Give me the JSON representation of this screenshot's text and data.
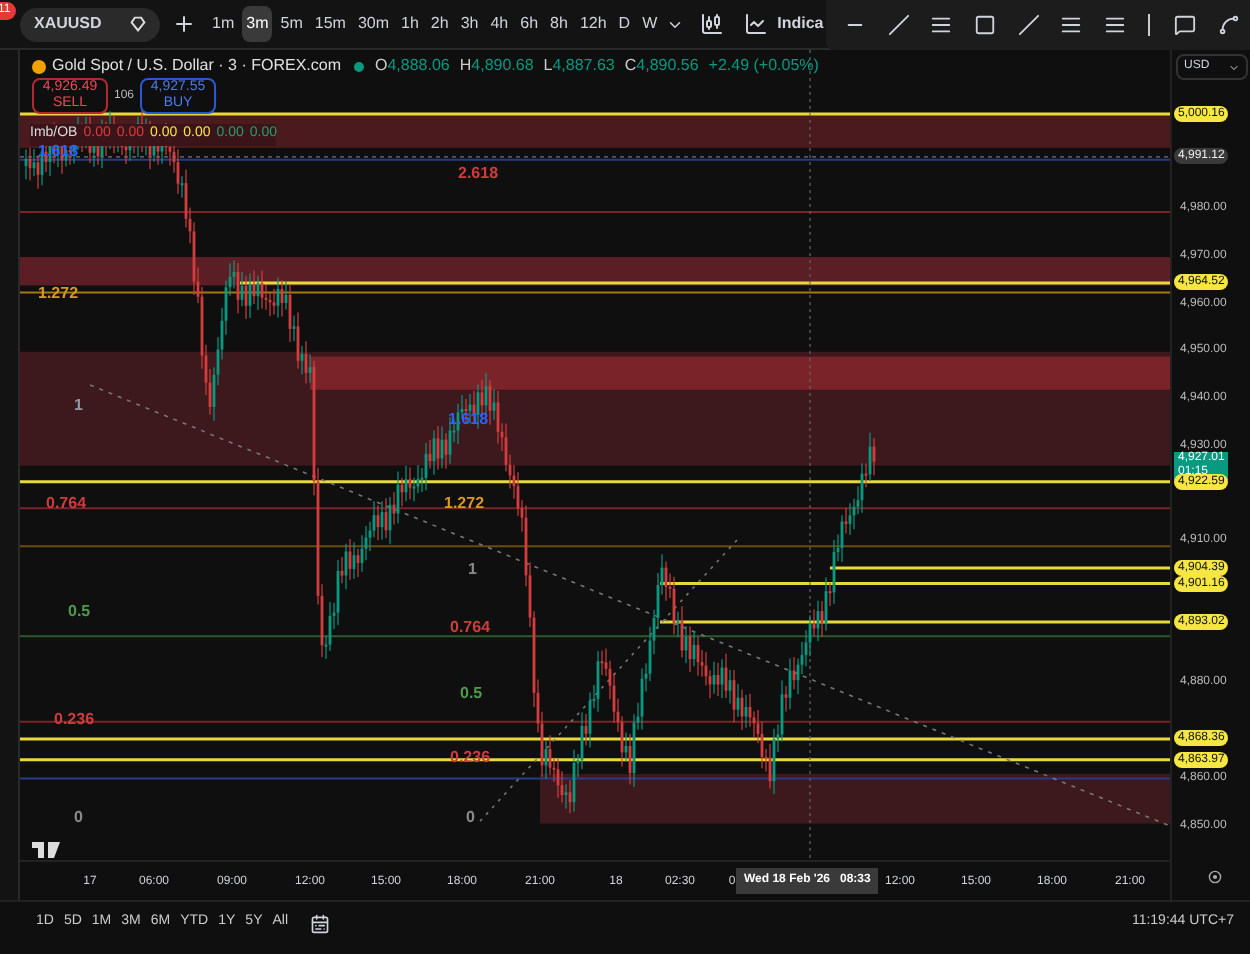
{
  "toolbar": {
    "badge": "11",
    "symbol": "XAUUSD",
    "intervals": [
      {
        "label": "1m",
        "selected": false
      },
      {
        "label": "3m",
        "selected": true
      },
      {
        "label": "5m",
        "selected": false
      },
      {
        "label": "15m",
        "selected": false
      },
      {
        "label": "30m",
        "selected": false
      },
      {
        "label": "1h",
        "selected": false
      },
      {
        "label": "2h",
        "selected": false
      },
      {
        "label": "3h",
        "selected": false
      },
      {
        "label": "4h",
        "selected": false
      },
      {
        "label": "6h",
        "selected": false
      },
      {
        "label": "8h",
        "selected": false
      },
      {
        "label": "12h",
        "selected": false
      },
      {
        "label": "D",
        "selected": false
      },
      {
        "label": "W",
        "selected": false
      }
    ],
    "indicators": "Indica"
  },
  "legend": {
    "title": "Gold Spot / U.S. Dollar · 3 · FOREX.com",
    "ohlc": [
      {
        "key": "O",
        "value": "4,888.06"
      },
      {
        "key": "H",
        "value": "4,890.68"
      },
      {
        "key": "L",
        "value": "4,887.63"
      },
      {
        "key": "C",
        "value": "4,890.56"
      }
    ],
    "change": "+2.49 (+0.05%)",
    "sell": {
      "price": "4,926.49",
      "label": "SELL"
    },
    "spread": "106",
    "buy": {
      "price": "4,927.55",
      "label": "BUY"
    }
  },
  "imbalance": {
    "label": "Imb/OB",
    "values": [
      {
        "text": "0.00",
        "color": "#e03a3a"
      },
      {
        "text": "0.00",
        "color": "#e03a3a"
      },
      {
        "text": "0.00",
        "color": "#f5e642"
      },
      {
        "text": "0.00",
        "color": "#f5e642"
      },
      {
        "text": "0.00",
        "color": "#22a06b"
      },
      {
        "text": "0.00",
        "color": "#22a06b"
      }
    ]
  },
  "currency": "USD",
  "price_axis": [
    {
      "kind": "badge",
      "text": "5,000.16",
      "color": "#f5e642"
    },
    {
      "kind": "badge",
      "text": "4,991.12",
      "color": "#3a3a3a"
    },
    {
      "kind": "tick",
      "text": "4,980.00"
    },
    {
      "kind": "tick",
      "text": "4,970.00"
    },
    {
      "kind": "badge",
      "text": "4,964.52",
      "color": "#f5e642"
    },
    {
      "kind": "tick",
      "text": "4,960.00"
    },
    {
      "kind": "tick",
      "text": "4,950.00"
    },
    {
      "kind": "tick",
      "text": "4,940.00"
    },
    {
      "kind": "tick",
      "text": "4,930.00"
    },
    {
      "kind": "live",
      "text": "4,927.01",
      "sub": "01:15",
      "color": "#089981"
    },
    {
      "kind": "badge",
      "text": "4,922.59",
      "color": "#f5e642"
    },
    {
      "kind": "tick",
      "text": "4,910.00"
    },
    {
      "kind": "badge",
      "text": "4,904.39",
      "color": "#f5e642"
    },
    {
      "kind": "badge",
      "text": "4,901.16",
      "color": "#f5e642"
    },
    {
      "kind": "badge",
      "text": "4,893.02",
      "color": "#f5e642"
    },
    {
      "kind": "tick",
      "text": "4,880.00"
    },
    {
      "kind": "badge",
      "text": "4,868.36",
      "color": "#f5e642"
    },
    {
      "kind": "badge",
      "text": "4,863.97",
      "color": "#f5e642"
    },
    {
      "kind": "tick",
      "text": "4,860.00"
    },
    {
      "kind": "tick",
      "text": "4,850.00"
    }
  ],
  "fib_labels": [
    {
      "text": "1.618",
      "color": "#2962ff"
    },
    {
      "text": "2.618",
      "color": "#d23b3b"
    },
    {
      "text": "1.272",
      "color": "#d99a1c"
    },
    {
      "text": "1",
      "color": "#9598a1"
    },
    {
      "text": "1.618",
      "color": "#2962ff"
    },
    {
      "text": "0.764",
      "color": "#d23b3b"
    },
    {
      "text": "1.272",
      "color": "#d99a1c"
    },
    {
      "text": "1",
      "color": "#8a8a8a"
    },
    {
      "text": "0.5",
      "color": "#4e9a4e"
    },
    {
      "text": "0.764",
      "color": "#d23b3b"
    },
    {
      "text": "0.5",
      "color": "#4e9a4e"
    },
    {
      "text": "0.236",
      "color": "#d23b3b"
    },
    {
      "text": "0.236",
      "color": "#d23b3b"
    },
    {
      "text": "0",
      "color": "#8a8a8a"
    },
    {
      "text": "0",
      "color": "#8a8a8a"
    }
  ],
  "time_axis": [
    "17",
    "06:00",
    "09:00",
    "12:00",
    "15:00",
    "18:00",
    "21:00",
    "18",
    "02:30",
    "0",
    "12:00",
    "15:00",
    "18:00",
    "21:00"
  ],
  "crosshair_time": "Wed 18 Feb '26   08:33",
  "ranges": [
    "1D",
    "5D",
    "1M",
    "3M",
    "6M",
    "YTD",
    "1Y",
    "5Y",
    "All"
  ],
  "clock": "11:19:44 UTC+7"
}
